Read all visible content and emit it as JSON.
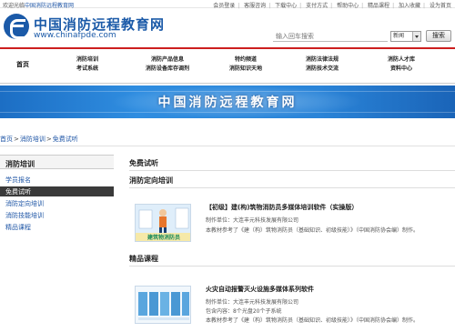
{
  "topbar": {
    "welcome_prefix": "欢迎光临",
    "welcome_site": "中国消防远程教育网",
    "links": [
      "会员登录",
      "客服咨询",
      "下载中心",
      "支付方式",
      "帮助中心",
      "精品课程",
      "加入收藏",
      "设为首页"
    ]
  },
  "logo": {
    "name": "中国消防远程教育网",
    "url": "www.chinafpde.com"
  },
  "search": {
    "placeholder": "输入回车搜索",
    "category": "新闻",
    "button": "搜索"
  },
  "nav": {
    "home": "首页",
    "columns": [
      [
        "消防培训",
        "考试系统"
      ],
      [
        "消防产品信息",
        "消防设备库存调剂"
      ],
      [
        "特约频道",
        "消防知识天地"
      ],
      [
        "消防法律法规",
        "消防技术交流"
      ],
      [
        "消防人才库",
        "资料中心"
      ]
    ]
  },
  "banner": {
    "title": "中国消防远程教育网"
  },
  "breadcrumb": [
    "首页",
    "消防培训",
    "免费试听"
  ],
  "sidebar": {
    "title": "消防培训",
    "items": [
      "学员报名",
      "免费试听",
      "消防定向培训",
      "消防技能培训",
      "精品课程"
    ],
    "active_index": 1
  },
  "main": {
    "page_heading": "免费试听",
    "section1_heading": "消防定向培训",
    "course1": {
      "title": "【初级】建(构)筑物消防员多媒体培训软件（实操版）",
      "maker": "制作单位：大连丰元科技发展有限公司",
      "desc": "本教材参考了《建（构）筑物消防员（基础知识、初级技能）》（中国消防协会编）制作。",
      "thumb_caption": "建筑物消防员"
    },
    "section2_heading": "精品课程",
    "course2": {
      "title": "火灾自动报警灭火设施多媒体系列软件",
      "maker": "制作单位：大连丰元科技发展有限公司",
      "extra": "包含内容：8个光盘20个子系统",
      "desc": "本教材参考了《建（构）筑物消防员（基础知识、初级技能）》（中国消防协会编）制作。"
    }
  },
  "colors": {
    "brand_blue": "#1b5aa8",
    "nav_red": "#cc1e1e",
    "link_blue": "#1f56a6",
    "active_dark": "#3a3a3a"
  },
  "icons": {
    "logo": "fire-e-logo-icon",
    "select": "chevron-down-icon"
  }
}
